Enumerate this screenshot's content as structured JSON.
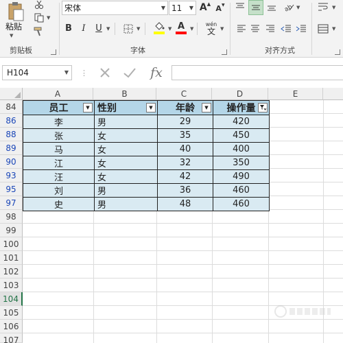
{
  "ribbon": {
    "clipboard": {
      "paste_label": "粘贴",
      "group_label": "剪贴板"
    },
    "font": {
      "font_name": "宋体",
      "font_size": "11",
      "bold": "B",
      "italic": "I",
      "underline": "U",
      "wen_label": "wén",
      "wen_char": "文",
      "group_label": "字体",
      "fill_color": "#ffff00",
      "font_color": "#ff0000"
    },
    "alignment": {
      "group_label": "对齐方式"
    }
  },
  "formula_bar": {
    "name_box": "H104",
    "fx": "fx",
    "value": ""
  },
  "sheet": {
    "columns": [
      "A",
      "B",
      "C",
      "D",
      "E"
    ],
    "row_headers": [
      "84",
      "86",
      "88",
      "89",
      "90",
      "93",
      "95",
      "97",
      "98",
      "99",
      "100",
      "101",
      "102",
      "103",
      "104",
      "105",
      "106",
      "107"
    ],
    "table": {
      "headers": [
        "员工",
        "性别",
        "年龄",
        "操作量"
      ],
      "rows": [
        [
          "李",
          "男",
          "29",
          "420"
        ],
        [
          "张",
          "女",
          "35",
          "450"
        ],
        [
          "马",
          "女",
          "40",
          "400"
        ],
        [
          "江",
          "女",
          "32",
          "350"
        ],
        [
          "汪",
          "女",
          "42",
          "490"
        ],
        [
          "刘",
          "男",
          "36",
          "460"
        ],
        [
          "史",
          "男",
          "48",
          "460"
        ]
      ]
    }
  }
}
